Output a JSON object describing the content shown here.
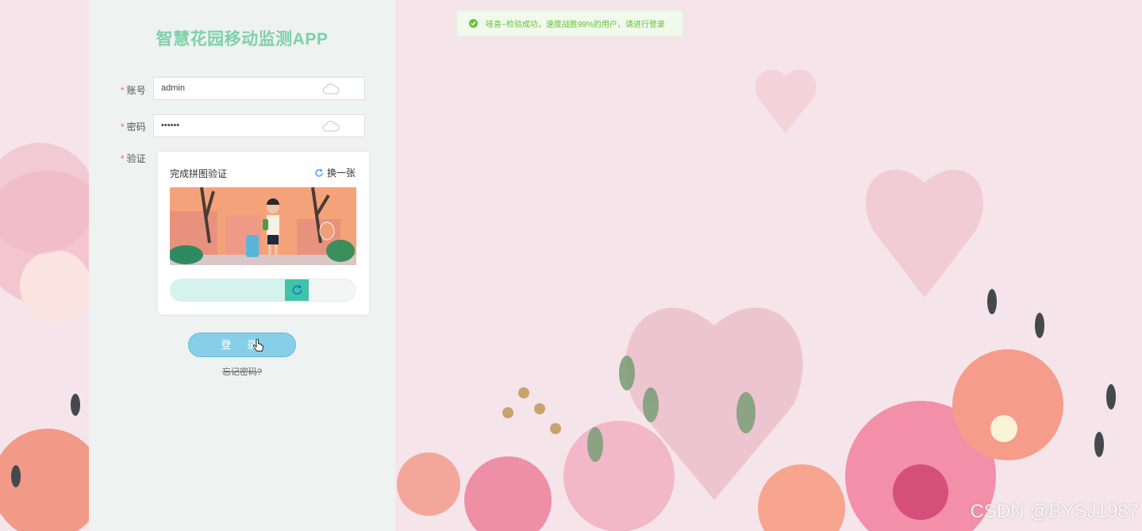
{
  "app": {
    "title": "智慧花园移动监测APP"
  },
  "form": {
    "account": {
      "required_mark": "*",
      "label": "账号",
      "value": "admin"
    },
    "password": {
      "required_mark": "*",
      "label": "密码",
      "value": "••••••"
    },
    "verify": {
      "required_mark": "*",
      "label": "验证"
    }
  },
  "captcha": {
    "title": "完成拼图验证",
    "refresh_label": "换一张",
    "slider_progress": 0.75
  },
  "actions": {
    "login_label": "登 录",
    "forgot_label": "忘记密码?"
  },
  "toast": {
    "message": "哇喜~检验成功，速度战胜99%的用户，请进行登录"
  },
  "watermark": "CSDN @BYSJ1987",
  "colors": {
    "accent": "#3ec4a8",
    "success": "#67c23a",
    "button": "#87cfe9"
  }
}
